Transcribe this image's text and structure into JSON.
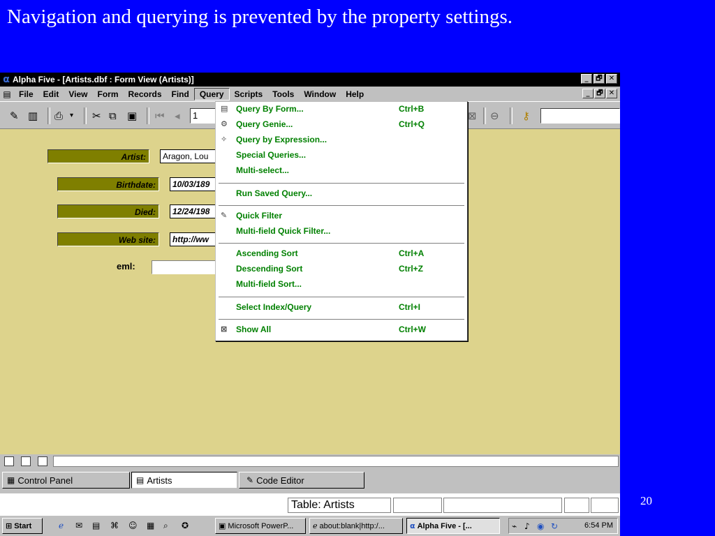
{
  "slide": {
    "title": "Navigation and querying is prevented by the property settings.",
    "number": "20"
  },
  "window": {
    "title": "Alpha Five - [Artists.dbf : Form View (Artists)]",
    "app_icon": "α",
    "controls": [
      "_",
      "🗗",
      "✕"
    ]
  },
  "menubar": {
    "items": [
      "File",
      "Edit",
      "View",
      "Form",
      "Records",
      "Find",
      "Query",
      "Scripts",
      "Tools",
      "Window",
      "Help"
    ],
    "active": "Query",
    "mdi_controls": [
      "_",
      "🗗",
      "✕"
    ]
  },
  "toolbar": {
    "record_field_value": "1",
    "search_field_value": ""
  },
  "form": {
    "fields": [
      {
        "label": "Artist:",
        "value": "Aragon, Lou"
      },
      {
        "label": "Birthdate:",
        "value": "10/03/189"
      },
      {
        "label": "Died:",
        "value": "12/24/198"
      },
      {
        "label": "Web site:",
        "value": "http://ww"
      }
    ],
    "eml_label": "eml:",
    "eml_value": ""
  },
  "query_menu": {
    "items": [
      {
        "label": "Query By Form...",
        "shortcut": "Ctrl+B",
        "icon": "query-form-icon"
      },
      {
        "label": "Query Genie...",
        "shortcut": "Ctrl+Q",
        "icon": "query-genie-icon"
      },
      {
        "label": "Query by Expression...",
        "shortcut": "",
        "icon": "query-expression-icon"
      },
      {
        "label": "Special Queries...",
        "shortcut": "",
        "icon": ""
      },
      {
        "label": "Multi-select...",
        "shortcut": "",
        "icon": ""
      },
      {
        "label": "Run Saved Query...",
        "shortcut": "",
        "icon": ""
      },
      {
        "label": "Quick Filter",
        "shortcut": "",
        "icon": "quick-filter-icon"
      },
      {
        "label": "Multi-field Quick Filter...",
        "shortcut": "",
        "icon": ""
      },
      {
        "label": "Ascending Sort",
        "shortcut": "Ctrl+A",
        "icon": ""
      },
      {
        "label": "Descending Sort",
        "shortcut": "Ctrl+Z",
        "icon": ""
      },
      {
        "label": "Multi-field Sort...",
        "shortcut": "",
        "icon": ""
      },
      {
        "label": "Select Index/Query",
        "shortcut": "Ctrl+I",
        "icon": ""
      },
      {
        "label": "Show All",
        "shortcut": "Ctrl+W",
        "icon": "show-all-icon"
      }
    ]
  },
  "doc_tabs": [
    {
      "label": "Control Panel",
      "icon": "control-panel-icon"
    },
    {
      "label": "Artists",
      "icon": "form-icon"
    },
    {
      "label": "Code Editor",
      "icon": "code-editor-icon"
    }
  ],
  "status": {
    "table_label": "Table: Artists"
  },
  "taskbar": {
    "start_label": "Start",
    "tasks": [
      "Microsoft PowerP...",
      "about:blank|http:/...",
      "Alpha Five - [..."
    ],
    "clock": "6:54 PM"
  },
  "colors": {
    "slide_background": "#0000ff",
    "form_background": "#ddd38c",
    "label_background": "#7f7f00",
    "menu_text": "#008000"
  }
}
